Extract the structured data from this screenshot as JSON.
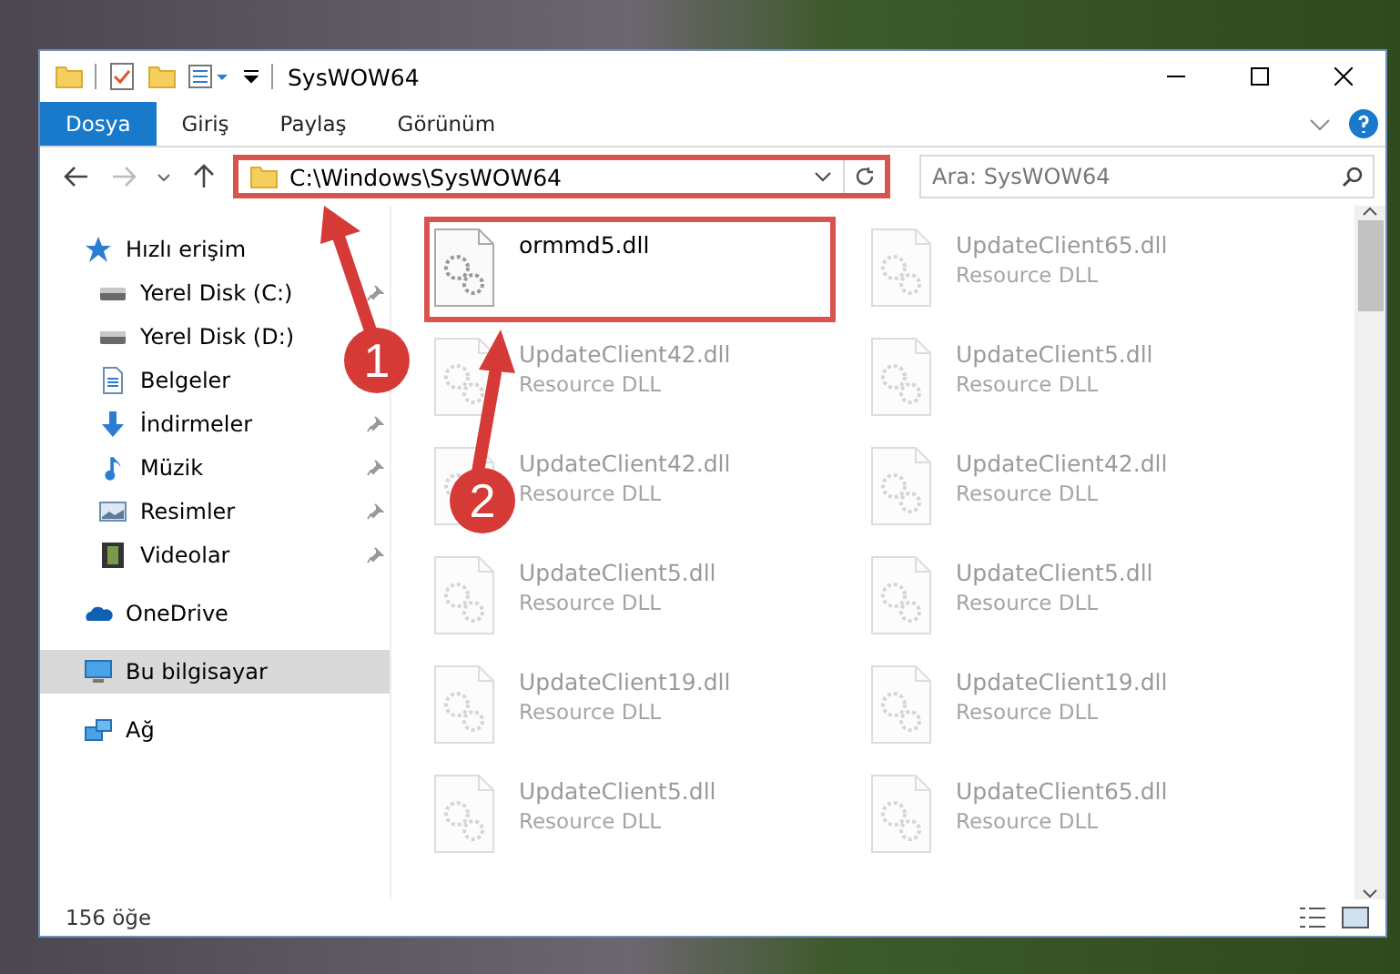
{
  "window": {
    "title": "SysWOW64"
  },
  "ribbon": {
    "tabs": [
      {
        "label": "Dosya",
        "selected": true
      },
      {
        "label": "Giriş",
        "selected": false
      },
      {
        "label": "Paylaş",
        "selected": false
      },
      {
        "label": "Görünüm",
        "selected": false
      }
    ]
  },
  "address": {
    "path": "C:\\Windows\\SysWOW64",
    "highlighted": true
  },
  "search": {
    "placeholder": "Ara: SysWOW64"
  },
  "sidebar": {
    "items": [
      {
        "label": "Hızlı erişim",
        "kind": "star",
        "selected": false,
        "children": [
          {
            "label": "Yerel Disk (C:)",
            "kind": "drive",
            "pinned": true
          },
          {
            "label": "Yerel Disk (D:)",
            "kind": "drive",
            "pinned": false
          },
          {
            "label": "Belgeler",
            "kind": "document",
            "pinned": false
          },
          {
            "label": "İndirmeler",
            "kind": "download",
            "pinned": true
          },
          {
            "label": "Müzik",
            "kind": "music",
            "pinned": true
          },
          {
            "label": "Resimler",
            "kind": "picture",
            "pinned": true
          },
          {
            "label": "Videolar",
            "kind": "film",
            "pinned": true
          }
        ]
      },
      {
        "label": "OneDrive",
        "kind": "cloud",
        "selected": false
      },
      {
        "label": "Bu bilgisayar",
        "kind": "computer",
        "selected": true
      },
      {
        "label": "Ağ",
        "kind": "network",
        "selected": false
      }
    ]
  },
  "files": [
    {
      "name": "ormmd5.dll",
      "faded": false,
      "highlighted": true
    },
    {
      "name": "UpdateClient65.dll",
      "type": "Resource DLL",
      "faded": true,
      "highlighted": false
    },
    {
      "name": "UpdateClient42.dll",
      "type": "Resource DLL",
      "faded": true,
      "highlighted": false
    },
    {
      "name": "UpdateClient5.dll",
      "type": "Resource DLL",
      "faded": true,
      "highlighted": false
    },
    {
      "name": "UpdateClient42.dll",
      "type": "Resource DLL",
      "faded": true,
      "highlighted": false
    },
    {
      "name": "UpdateClient42.dll",
      "type": "Resource DLL",
      "faded": true,
      "highlighted": false
    },
    {
      "name": "UpdateClient5.dll",
      "type": "Resource DLL",
      "faded": true,
      "highlighted": false
    },
    {
      "name": "UpdateClient5.dll",
      "type": "Resource DLL",
      "faded": true,
      "highlighted": false
    },
    {
      "name": "UpdateClient19.dll",
      "type": "Resource DLL",
      "faded": true,
      "highlighted": false
    },
    {
      "name": "UpdateClient19.dll",
      "type": "Resource DLL",
      "faded": true,
      "highlighted": false
    },
    {
      "name": "UpdateClient5.dll",
      "type": "Resource DLL",
      "faded": true,
      "highlighted": false
    },
    {
      "name": "UpdateClient65.dll",
      "type": "Resource DLL",
      "faded": true,
      "highlighted": false
    }
  ],
  "annotations": [
    {
      "label": "1"
    },
    {
      "label": "2"
    }
  ],
  "status_bar": {
    "count": "156 öğe"
  }
}
